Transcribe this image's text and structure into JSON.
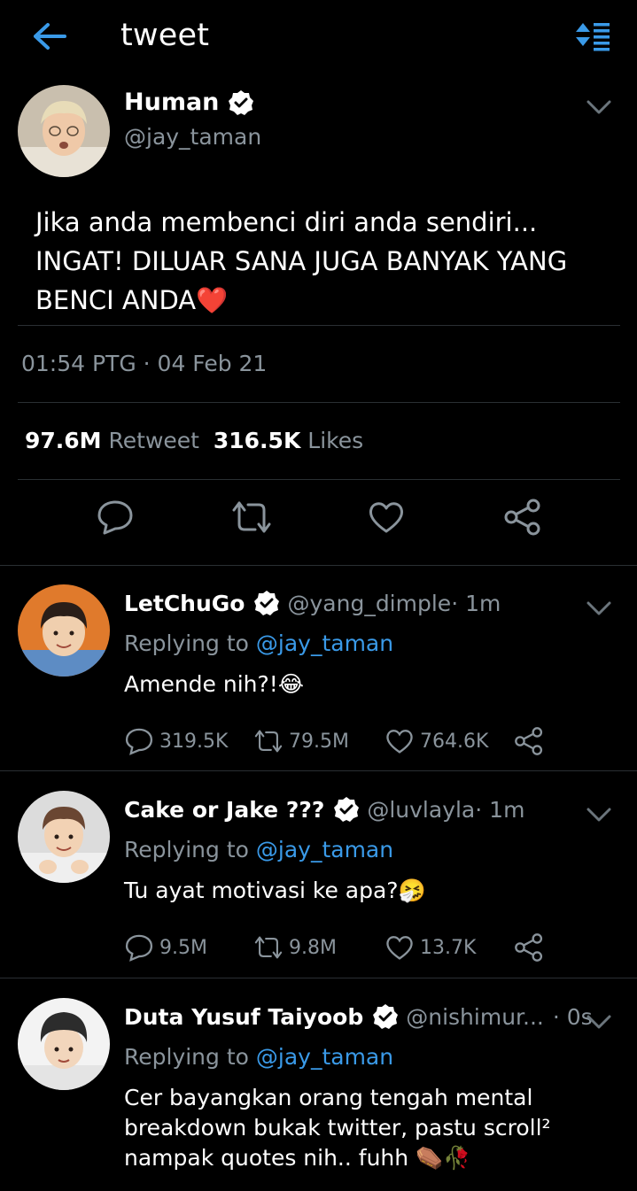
{
  "header": {
    "title": "tweet",
    "back_icon": "arrow-left-icon",
    "sort_icon": "sort-icon",
    "accent": "#3a9ae8"
  },
  "tweet": {
    "name": "Human",
    "handle": "@jay_taman",
    "text_line1": "Jika anda membenci diri anda sendiri...",
    "text_line2": "INGAT! DILUAR SANA JUGA BANYAK YANG",
    "text_line3": "BENCI ANDA",
    "text_emoji": "❤️",
    "timestamp": "01:54 PTG · 04 Feb 21",
    "retweets": "97.6M",
    "retweet_label": "Retweet",
    "likes": "316.5K",
    "likes_label": "Likes"
  },
  "replies": [
    {
      "name": "LetChuGo",
      "handle": "@yang_dimple",
      "time": " · 1m",
      "replying_prefix": "Replying to ",
      "replying_to": "@jay_taman",
      "text": "Amende nih?!",
      "emoji": "😂",
      "reply_count": "319.5K",
      "retweet_count": "79.5M",
      "like_count": "764.6K"
    },
    {
      "name": "Cake or Jake ???",
      "handle": "@luvlayla",
      "time": " · 1m",
      "replying_prefix": "Replying to ",
      "replying_to": "@jay_taman",
      "text": "Tu ayat motivasi ke apa?",
      "emoji": "🤧",
      "reply_count": "9.5M",
      "retweet_count": "9.8M",
      "like_count": "13.7K"
    },
    {
      "name": "Duta Yusuf Taiyoob",
      "handle": "@nishimur...",
      "time": " · 0s",
      "replying_prefix": "Replying to ",
      "replying_to": "@jay_taman",
      "text_line1": "Cer bayangkan orang tengah mental",
      "text_line2": "breakdown bukak twitter, pastu scroll²",
      "text_line3": "nampak quotes nih.. fuhh",
      "emoji": "⚰️🥀"
    }
  ]
}
